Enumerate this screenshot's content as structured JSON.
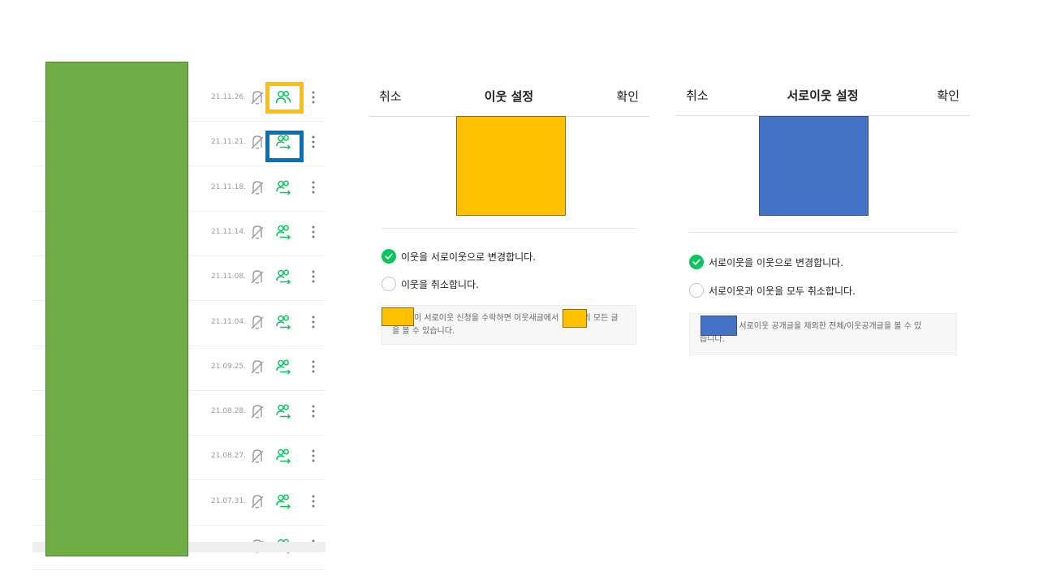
{
  "colors": {
    "accent_green": "#03c75a",
    "mask_green": "#70ad47",
    "highlight_yellow": "#ffc000",
    "highlight_blue": "#0070c0",
    "mask_blue": "#4472c4"
  },
  "neighbor_list": {
    "rows": [
      {
        "date": "21.11.26.",
        "icons": [
          "mute-icon",
          "neighbor-icon",
          "more-icon"
        ]
      },
      {
        "date": "21.11.21.",
        "icons": [
          "mute-icon",
          "mutual-neighbor-icon",
          "more-icon"
        ]
      },
      {
        "date": "21.11.18.",
        "icons": [
          "mute-icon",
          "mutual-neighbor-icon",
          "more-icon"
        ]
      },
      {
        "date": "21.11.14.",
        "icons": [
          "mute-icon",
          "mutual-neighbor-icon",
          "more-icon"
        ]
      },
      {
        "date": "21.11.08.",
        "icons": [
          "mute-icon",
          "mutual-neighbor-icon",
          "more-icon"
        ]
      },
      {
        "date": "21.11.04.",
        "icons": [
          "mute-icon",
          "mutual-neighbor-icon",
          "more-icon"
        ]
      },
      {
        "date": "21.09.25.",
        "icons": [
          "mute-icon",
          "mutual-neighbor-icon",
          "more-icon"
        ]
      },
      {
        "date": "21.08.28.",
        "icons": [
          "mute-icon",
          "mutual-neighbor-icon",
          "more-icon"
        ]
      },
      {
        "date": "21.08.27.",
        "icons": [
          "mute-icon",
          "mutual-neighbor-icon",
          "more-icon"
        ]
      },
      {
        "date": "21.07.31.",
        "icons": [
          "mute-icon",
          "mutual-neighbor-icon",
          "more-icon"
        ]
      },
      {
        "date": "",
        "icons": [
          "mute-icon",
          "mutual-neighbor-icon",
          "more-icon"
        ]
      }
    ]
  },
  "neighbor_dialog": {
    "cancel_label": "취소",
    "title": "이웃 설정",
    "confirm_label": "확인",
    "options": [
      {
        "label": "이웃을 서로이웃으로 변경합니다.",
        "checked": true
      },
      {
        "label": "이웃을 취소합니다.",
        "checked": false
      }
    ],
    "info_line1": "이 서로이웃 신청을 수락하면 이웃새글에서 ",
    "info_line1_tail": "의 모든 글",
    "info_line2": "을 볼 수 있습니다."
  },
  "mutual_dialog": {
    "cancel_label": "취소",
    "title": "서로이웃 설정",
    "confirm_label": "확인",
    "options": [
      {
        "label": "서로이웃을 이웃으로 변경합니다.",
        "checked": true
      },
      {
        "label": "서로이웃과 이웃을 모두 취소합니다.",
        "checked": false
      }
    ],
    "info_line1": "의 서로이웃 공개글을 제외한 전체/이웃공개글을 볼 수 있",
    "info_line2": "습니다."
  }
}
